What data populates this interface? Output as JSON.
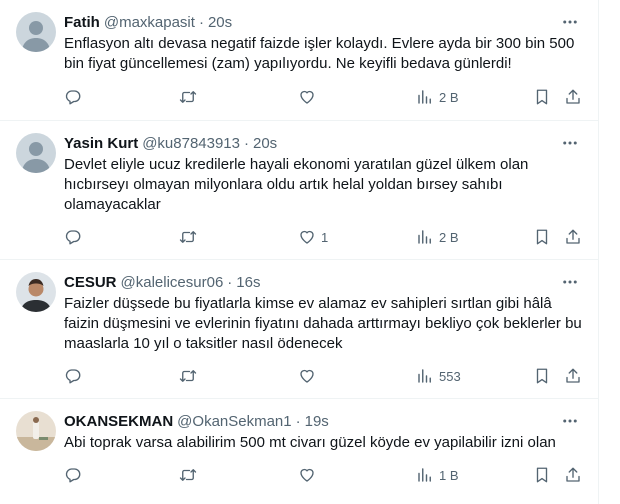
{
  "colors": {
    "text": "#0f1419",
    "muted": "#536471",
    "divider": "#eff3f4"
  },
  "icons": [
    "reply-icon",
    "retweet-icon",
    "like-icon",
    "views-icon",
    "bookmark-icon",
    "share-icon",
    "more-icon"
  ],
  "tweets": [
    {
      "name": "Fatih",
      "handle": "@maxkapasit",
      "dot": "·",
      "time": "20s",
      "text": "Enflasyon altı devasa negatif faizde işler kolaydı. Evlere ayda bir 300 bin 500 bin fiyat güncellemesi  (zam) yapılıyordu. Ne keyifli bedava günlerdi!",
      "replies": "",
      "retweets": "",
      "likes": "",
      "views": "2 B"
    },
    {
      "name": "Yasin Kurt",
      "handle": "@ku87843913",
      "dot": "·",
      "time": "20s",
      "text": "Devlet eliyle ucuz kredilerle hayali ekonomi yaratılan güzel ülkem olan hıcbırseyı olmayan milyonlara oldu artık helal yoldan bırsey sahıbı olamayacaklar",
      "replies": "",
      "retweets": "",
      "likes": "1",
      "views": "2 B"
    },
    {
      "name": "CESUR",
      "handle": "@kalelicesur06",
      "dot": "·",
      "time": "16s",
      "text": "Faizler düşsede bu fiyatlarla kimse ev alamaz  ev sahipleri sırtlan gibi hâlâ faizin düşmesini ve evlerinin fiyatını dahada arttırmayı bekliyo çok beklerler bu maaslarla 10 yıl o taksitler nasıl ödenecek",
      "replies": "",
      "retweets": "",
      "likes": "",
      "views": "553"
    },
    {
      "name": "OKANSEKMAN",
      "handle": "@OkanSekman1",
      "dot": "·",
      "time": "19s",
      "text": "Abi toprak varsa alabilirim 500 mt civarı güzel köyde ev yapilabilir izni olan",
      "replies": "",
      "retweets": "",
      "likes": "",
      "views": "1 B"
    }
  ]
}
